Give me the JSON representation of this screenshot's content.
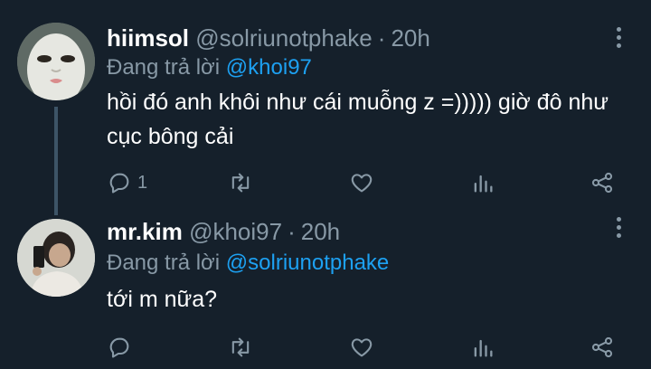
{
  "tweets": [
    {
      "display_name": "hiimsol",
      "handle": "@solriunotphake",
      "separator": "·",
      "time": "20h",
      "reply_prefix": "Đang trả lời",
      "reply_to": "@khoi97",
      "text": "hồi đó anh khôi như cái muỗng z =))))) giờ đô như cục bông cải",
      "reply_count": "1",
      "avatar_icon": "masked-face-avatar"
    },
    {
      "display_name": "mr.kim",
      "handle": "@khoi97",
      "separator": "·",
      "time": "20h",
      "reply_prefix": "Đang trả lời",
      "reply_to": "@solriunotphake",
      "text": "tới m nữa?",
      "reply_count": "",
      "avatar_icon": "mirror-selfie-avatar"
    }
  ],
  "colors": {
    "background": "#15202b",
    "secondary_text": "#8899a6",
    "accent": "#1da1f2",
    "thread_line": "#3d5466"
  },
  "icons": [
    "reply-icon",
    "retweet-icon",
    "like-icon",
    "analytics-icon",
    "share-icon",
    "more-options-icon"
  ]
}
